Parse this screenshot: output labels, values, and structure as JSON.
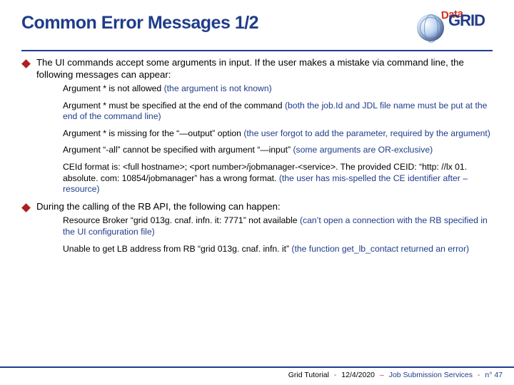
{
  "title": "Common Error Messages 1/2",
  "logo": {
    "data": "Data",
    "grid": "GRID"
  },
  "section1": {
    "lead": "The UI commands accept some arguments in input. If the user makes a mistake via command line, the following messages can appear:",
    "items": [
      {
        "msg": "Argument * is not allowed ",
        "explain": "(the argument is not known)"
      },
      {
        "msg": "Argument * must be specified at the end of the command ",
        "explain": "(both the job.Id and JDL file name must be put at the end of the command line)"
      },
      {
        "msg": "Argument * is missing for the “—output” option ",
        "explain": "(the user forgot to add the parameter, required by the argument)"
      },
      {
        "msg": "Argument “-all” cannot be specified with argument “—input” ",
        "explain": "(some arguments are OR-exclusive)"
      },
      {
        "msg": "CEId format is: <full hostname>; <port number>/jobmanager-<service>. The provided CEID: “http: //lx 01. absolute. com: 10854/jobmanager” has a wrong format. ",
        "explain": "(the user has mis-spelled the CE identifier after –resource)"
      }
    ]
  },
  "section2": {
    "lead": "During the calling of the RB API, the following can happen:",
    "items": [
      {
        "msg": "Resource Broker “grid 013g. cnaf. infn. it: 7771” not available ",
        "explain": "(can’t open a connection with the RB specified in the UI configuration file)"
      },
      {
        "msg": "Unable to get LB address from RB “grid 013g. cnaf. infn. it” ",
        "explain": "(the function get_lb_contact returned an error)"
      }
    ]
  },
  "footer": {
    "left": "Grid Tutorial",
    "date": "12/4/2020",
    "mid": "Job Submission Services",
    "page": "n° 47"
  }
}
